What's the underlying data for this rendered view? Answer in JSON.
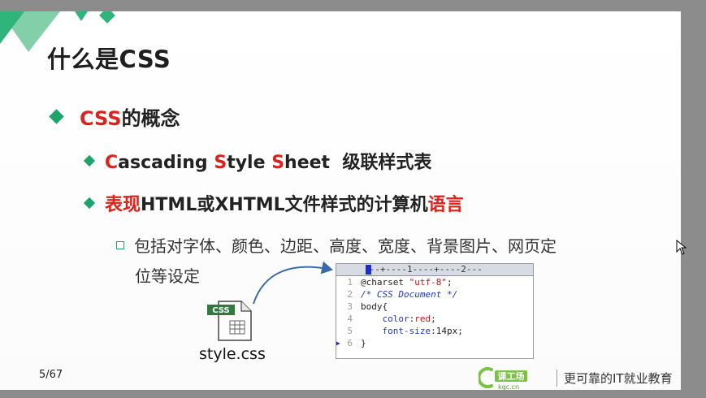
{
  "slide": {
    "title": "什么是CSS",
    "bullet1": {
      "prefix": "CSS",
      "rest": "的概念"
    },
    "bullet2": {
      "c1": "C",
      "t1": "ascading ",
      "c2": "S",
      "t2": "tyle ",
      "c3": "S",
      "t3": "heet  级联样式表"
    },
    "bullet3": {
      "red1": "表现",
      "middle": "HTML或XHTML文件样式的计算机",
      "red2": "语言"
    },
    "bullet4": {
      "line1": "包括对字体、颜色、边距、高度、宽度、背景图片、网页定",
      "line2": "位等设定"
    },
    "file_label": "style.css",
    "file_tag": "CSS",
    "page_number": "5/67"
  },
  "code": {
    "ruler": "---+----1----+----2---",
    "lines": [
      {
        "num": "1",
        "a": "@charset ",
        "b": "\"utf-8\"",
        "c": ";"
      },
      {
        "num": "2",
        "comment": "/* CSS Document */"
      },
      {
        "num": "3",
        "a": "body{"
      },
      {
        "num": "4",
        "a": "    ",
        "k": "color",
        "c": ":",
        "v": "red",
        "d": ";"
      },
      {
        "num": "5",
        "a": "    ",
        "k": "font-size",
        "c": ":14px;"
      },
      {
        "num": "6",
        "a": "}"
      }
    ]
  },
  "logo": {
    "brand": "课工场",
    "domain": "kgc.cn",
    "tagline": "更可靠的IT就业教育"
  },
  "colors": {
    "accent_green": "#1ba56a",
    "highlight_red": "#e0201a",
    "code_blue": "#1f39c8"
  }
}
